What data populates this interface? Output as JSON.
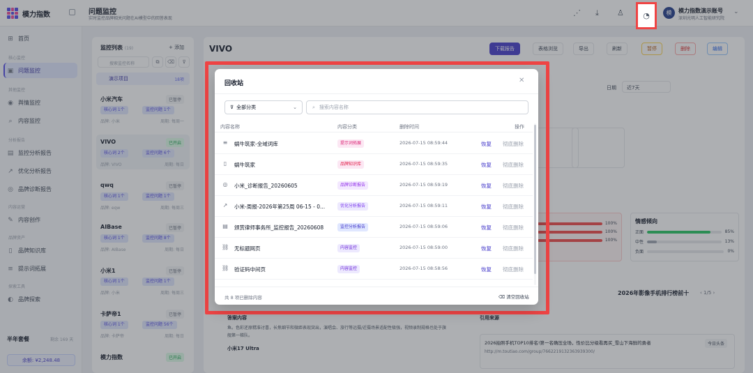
{
  "app": {
    "name": "模力指数",
    "page_title": "问题监控",
    "page_subtitle": "实时监控品牌相关问题在AI模型中的回答表现"
  },
  "account": {
    "avatar": "模",
    "name": "模力指数演示账号",
    "org": "深圳光明人工智能研究院"
  },
  "sidebar": {
    "home": "首页",
    "sections": [
      "核心监控",
      "其他监控",
      "分析报告",
      "内容运营",
      "品牌资产",
      "探索工具"
    ],
    "items": [
      "问题监控",
      "舆情监控",
      "内容监控",
      "监控分析报告",
      "优化分析报告",
      "品牌诊断报告",
      "内容创作",
      "品牌知识库",
      "提示词拓展",
      "品牌探索"
    ],
    "plan": "半年套餐",
    "plan_remaining": "剩余 169 天",
    "balance": "余额: ¥2,248.48"
  },
  "list": {
    "title": "监控列表",
    "count": "(19)",
    "add": "+ 添加",
    "search_placeholder": "搜索监控名称",
    "group": {
      "name": "演示项目",
      "count": "18项"
    },
    "projects": [
      {
        "name": "小米汽车",
        "status": "已暂停",
        "core": "核心词 1个",
        "monitor": "监控问题 1个",
        "brand": "品牌: 小米",
        "cycle": "周期: 每周一"
      },
      {
        "name": "VIVO",
        "status": "已开启",
        "core": "核心词 2个",
        "monitor": "监控问题 6个",
        "brand": "品牌: VIVO",
        "cycle": "周期: 每日"
      },
      {
        "name": "qwq",
        "status": "已暂停",
        "core": "核心词 1个",
        "monitor": "监控问题 1个",
        "brand": "品牌: eqw",
        "cycle": "周期: 每周三"
      },
      {
        "name": "AIBase",
        "status": "已暂停",
        "core": "核心词 1个",
        "monitor": "监控问题 8个",
        "brand": "品牌: AIBase",
        "cycle": "周期: 每日"
      },
      {
        "name": "小米1",
        "status": "已暂停",
        "core": "核心词 1个",
        "monitor": "监控问题 1个",
        "brand": "品牌: 小米",
        "cycle": "周期: 每周三"
      },
      {
        "name": "卡萨帝1",
        "status": "已暂停",
        "core": "核心词 1个",
        "monitor": "监控问题 56个",
        "brand": "品牌: 卡萨帝",
        "cycle": "周期: 每日"
      },
      {
        "name": "模力指数",
        "status": "已开启"
      }
    ]
  },
  "main": {
    "title": "VIVO",
    "buttons": {
      "download": "下载报告",
      "table": "表格浏览",
      "export": "导出",
      "refresh": "刷新",
      "pause": "暂停",
      "delete": "删除",
      "edit": "编辑"
    },
    "date_label": "日期",
    "date_value": "近7天",
    "sentiment": {
      "title": "情感倾向",
      "rows": [
        {
          "label": "正面",
          "pct": "85%",
          "value": 85,
          "color": "#22c55e"
        },
        {
          "label": "中性",
          "pct": "13%",
          "value": 13,
          "color": "#9ca3af"
        },
        {
          "label": "负面",
          "pct": "0%",
          "value": 0,
          "color": "#ef4444"
        }
      ]
    },
    "red_rows": [
      "100%",
      "100%",
      "100%"
    ],
    "rank_title": "2026年影像手机排行榜前十",
    "rank_page": "1/5",
    "answer_label": "答案内容",
    "answer_text": "鱼。色彩还原精准讨喜，长焦细节和微距表现突出，演唱会、旅行等远摄/近摄场景适配性极强，视频录制规格也处于旗舰第一梯队。",
    "answer_model": "小米17 Ultra",
    "ref_label": "引用来源",
    "ref_title": "2026拍照手机TOP10排名!第一名确压全场，性价比分级看再买_雪山下海鲜的勇者",
    "ref_url": "http://m.toutiao.com/group/7662219132363939300/",
    "ref_tag": "今日头条"
  },
  "modal": {
    "title": "回收站",
    "category_select": "全部分类",
    "search_placeholder": "搜索内容名称",
    "headers": {
      "name": "内容名称",
      "category": "内容分类",
      "time": "删除时间",
      "action": "操作"
    },
    "rows": [
      {
        "icon": "list-icon",
        "glyph": "≡",
        "name": "蜗牛筑家-全域词库",
        "category": "提示词拓展",
        "cat_bg": "#fce7f3",
        "cat_fg": "#db2777",
        "time": "2026-07-15 08:59:44"
      },
      {
        "icon": "book-icon",
        "glyph": "▯",
        "name": "蜗牛筑家",
        "category": "品牌知识库",
        "cat_bg": "#fce7f3",
        "cat_fg": "#e11d48",
        "time": "2026-07-15 08:59:35"
      },
      {
        "icon": "shield-icon",
        "glyph": "◎",
        "name": "小米_诊断报告_20260605",
        "category": "品牌诊断报告",
        "cat_bg": "#f3e8ff",
        "cat_fg": "#9333ea",
        "time": "2026-07-15 08:59:19"
      },
      {
        "icon": "trend-icon",
        "glyph": "↗",
        "name": "小米-周报-2026年第25周 06-15 - 0...",
        "category": "优化分析报告",
        "cat_bg": "#ede9fe",
        "cat_fg": "#7c3aed",
        "time": "2026-07-15 08:59:11"
      },
      {
        "icon": "doc-icon",
        "glyph": "▤",
        "name": "颁赏律师事务所_监控报告_20260608",
        "category": "监控分析报告",
        "cat_bg": "#e0e7ff",
        "cat_fg": "#4338ca",
        "time": "2026-07-15 08:59:06"
      },
      {
        "icon": "link-icon",
        "glyph": "⛓",
        "name": "无标题网页",
        "category": "内容监控",
        "cat_bg": "#ede9fe",
        "cat_fg": "#6d28d9",
        "time": "2026-07-15 08:59:00"
      },
      {
        "icon": "link-icon",
        "glyph": "⛓",
        "name": "验证码中间页",
        "category": "内容监控",
        "cat_bg": "#ede9fe",
        "cat_fg": "#6d28d9",
        "time": "2026-07-15 08:58:56"
      }
    ],
    "restore": "恢复",
    "delete_forever": "彻底删除",
    "footer_count": "共 8 项已删除内容",
    "empty_bin": "清空回收站"
  }
}
